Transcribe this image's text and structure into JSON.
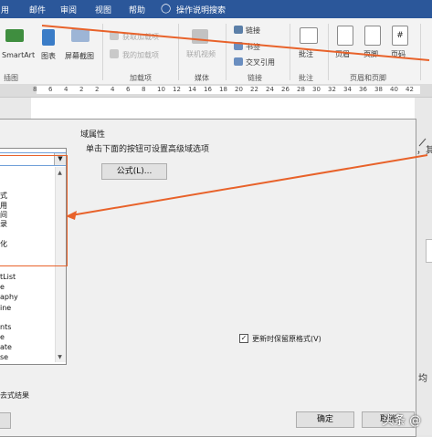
{
  "tabs": [
    "用",
    "邮件",
    "审阅",
    "视图",
    "帮助",
    "操作说明搜索"
  ],
  "ribbon": {
    "smartart": "SmartArt",
    "chart": "图表",
    "screenshot": "屏幕截图",
    "get_addins": "获取加载项",
    "my_addins": "我的加载项",
    "online_video": "联机视频",
    "link": "链接",
    "bookmark": "书签",
    "cross_ref": "交叉引用",
    "comment": "批注",
    "header": "页眉",
    "footer": "页脚",
    "page_num": "页码",
    "g_illus": "插图",
    "g_addins": "加载项",
    "g_media": "媒体",
    "g_links": "链接",
    "g_comments": "批注",
    "g_hf": "页眉和页脚"
  },
  "ruler": [
    "8",
    "6",
    "4",
    "2",
    "2",
    "4",
    "6",
    "8",
    "10",
    "12",
    "14",
    "16",
    "18",
    "20",
    "22",
    "24",
    "26",
    "28",
    "30",
    "32",
    "34",
    "36",
    "38",
    "40",
    "42"
  ],
  "dialog": {
    "field_props": "域属性",
    "hint": "单击下面的按钮可设置高级域选项",
    "formula_button": "公式(L)...",
    "list_items": [
      "式",
      "用",
      "间",
      "录",
      "化",
      "tList",
      "e",
      "aphy",
      "ine",
      "nts",
      "e",
      "ate",
      "se"
    ],
    "preserve_format": "更新时保留原格式(V)",
    "bottom_left": "去式结果",
    "ok": "确定",
    "cancel": "取消"
  },
  "doc_lines": [
    "，其去...",
    "均"
  ],
  "watermark": "头条 @"
}
